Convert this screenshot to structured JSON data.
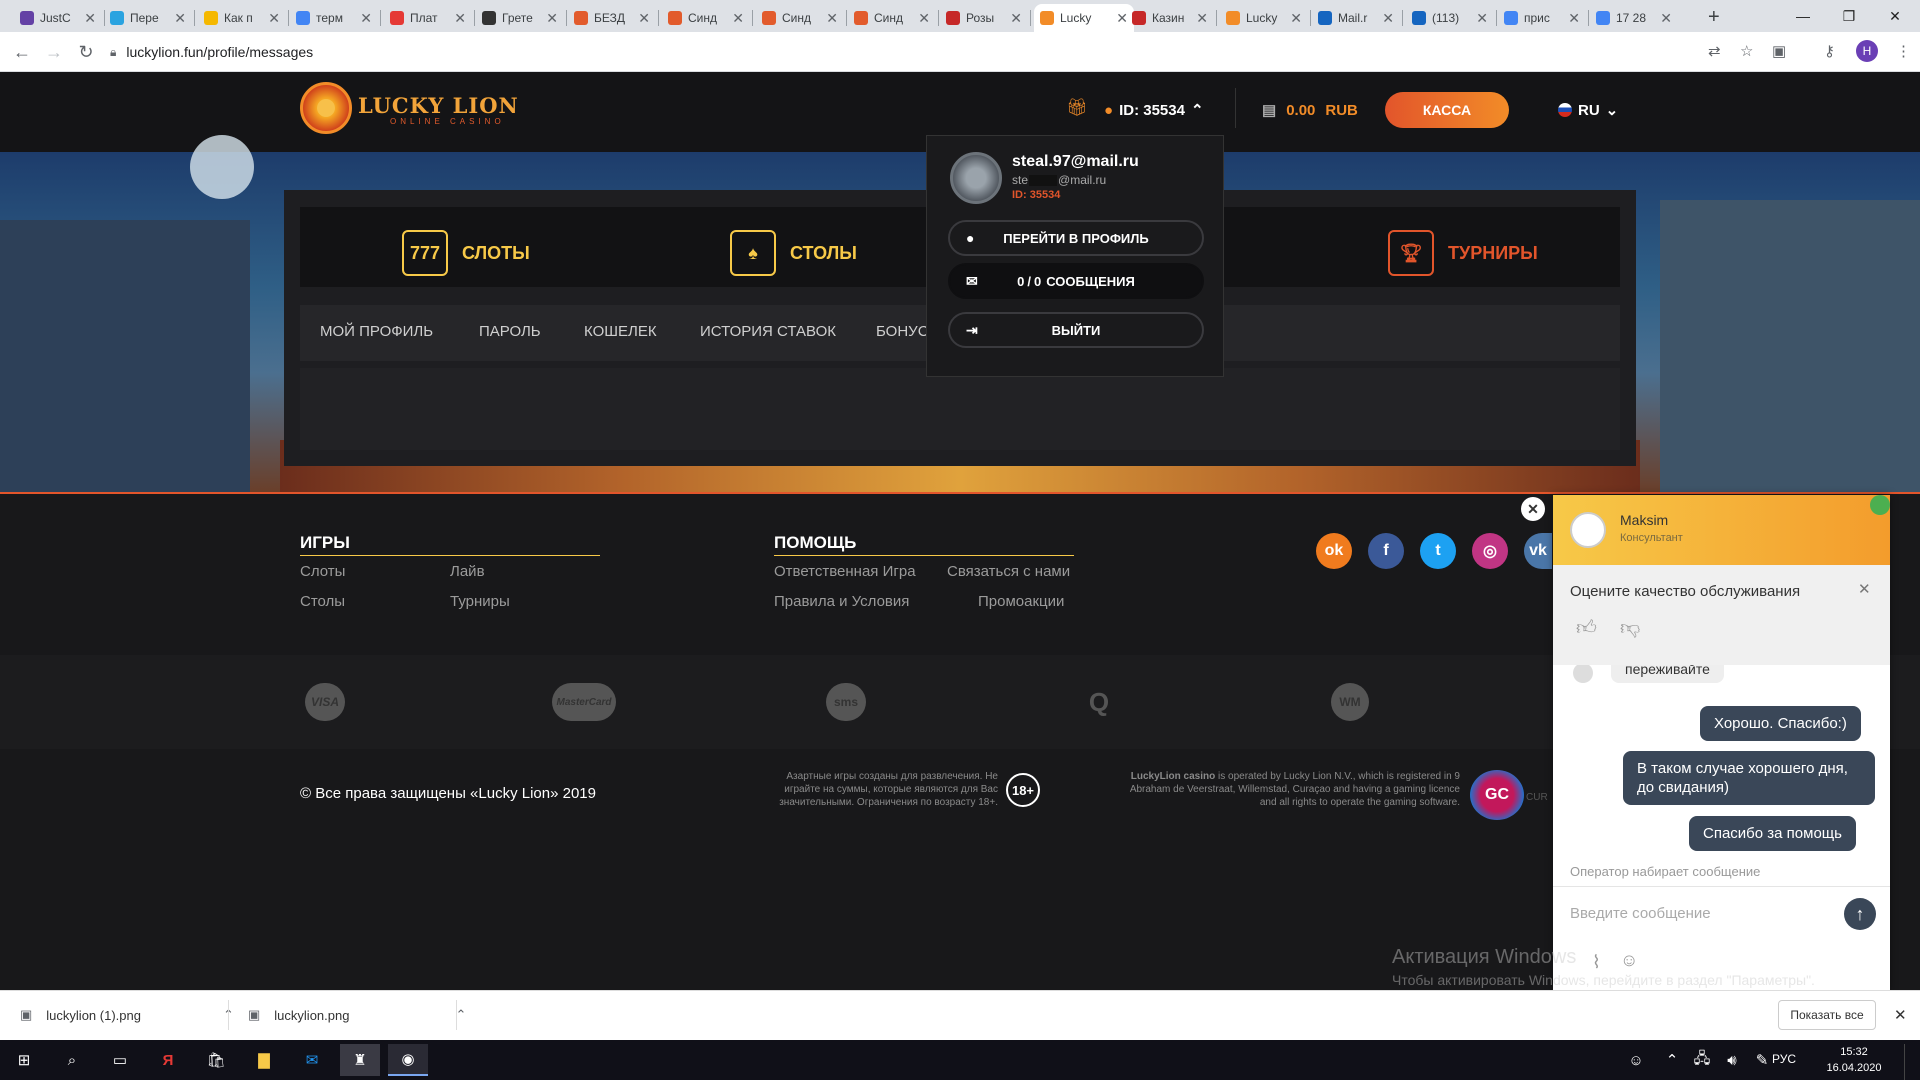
{
  "browser": {
    "tabs": [
      {
        "title": "JustC",
        "color": "#6441a5"
      },
      {
        "title": "Пере",
        "color": "#2aa3e0"
      },
      {
        "title": "Как п",
        "color": "#f5b800"
      },
      {
        "title": "терм",
        "color": "#4285f4"
      },
      {
        "title": "Плат",
        "color": "#e53935"
      },
      {
        "title": "Грете",
        "color": "#333333"
      },
      {
        "title": "БЕЗД",
        "color": "#e25b2c"
      },
      {
        "title": "Синд",
        "color": "#e25b2c"
      },
      {
        "title": "Синд",
        "color": "#e25b2c"
      },
      {
        "title": "Синд",
        "color": "#e25b2c"
      },
      {
        "title": "Розы",
        "color": "#c62828"
      },
      {
        "title": "Lucky",
        "color": "#f28c28",
        "active": true
      },
      {
        "title": "Казин",
        "color": "#c62828"
      },
      {
        "title": "Lucky",
        "color": "#f28c28"
      },
      {
        "title": "Mail.r",
        "color": "#1565c0"
      },
      {
        "title": "(113)",
        "color": "#1565c0"
      },
      {
        "title": "прис",
        "color": "#4285f4"
      },
      {
        "title": "17 28",
        "color": "#4285f4"
      }
    ],
    "new_tab": "+",
    "url": "luckylion.fun/profile/messages",
    "profile_letter": "H"
  },
  "header": {
    "logo_text": "LUCKY LION",
    "logo_sub": "ONLINE CASINO",
    "user_id": "ID: 35534",
    "balance": "0.00",
    "currency": "RUB",
    "cashier": "КАССА",
    "lang": "RU"
  },
  "dropdown": {
    "email": "steal.97@mail.ru",
    "email_masked_prefix": "ste",
    "email_masked_suffix": "@mail.ru",
    "id": "ID: 35534",
    "profile": "ПЕРЕЙТИ В ПРОФИЛЬ",
    "messages_count": "0",
    "messages_sep": "/",
    "messages_total": "0",
    "messages_label": "СООБЩЕНИЯ",
    "logout": "ВЫЙТИ"
  },
  "categories": [
    "СЛОТЫ",
    "СТОЛЫ",
    "ТУРНИРЫ"
  ],
  "profile_nav": [
    "МОЙ ПРОФИЛЬ",
    "ПАРОЛЬ",
    "КОШЕЛЕК",
    "ИСТОРИЯ СТАВОК",
    "БОНУС"
  ],
  "footer": {
    "games_title": "ИГРЫ",
    "games_links": [
      "Слоты",
      "Лайв",
      "Столы",
      "Турниры"
    ],
    "help_title": "ПОМОЩЬ",
    "help_links": [
      "Ответственная Игра",
      "Связаться с нами",
      "Правила и Условия",
      "Промоакции"
    ],
    "socials": [
      {
        "name": "ok",
        "glyph": "ok",
        "color": "#f07b1e"
      },
      {
        "name": "facebook",
        "glyph": "f",
        "color": "#3b5998"
      },
      {
        "name": "twitter",
        "glyph": "t",
        "color": "#1da1f2"
      },
      {
        "name": "instagram",
        "glyph": "◎",
        "color": "#c13584"
      },
      {
        "name": "vk",
        "glyph": "vk",
        "color": "#4a76a8"
      }
    ],
    "payments": [
      "VISA",
      "MasterCard",
      "sms",
      "Q",
      "WM"
    ],
    "copyright": "© Все права защищены «Lucky Lion» 2019",
    "disclaimer": "Азартные игры созданы для развлечения. Не играйте на суммы, которые являются для Вас значительными. Ограничения по возрасту 18+.",
    "age": "18+",
    "license_bold": "LuckyLion casino",
    "license": " is operated by Lucky Lion N.V., which is registered in 9 Abraham de Veerstraat, Willemstad, Curaçao and having a gaming licence and all rights to operate the gaming software.",
    "gc": "GC",
    "gc_suffix": "CUR"
  },
  "chat": {
    "agent_name": "Maksim",
    "agent_role": "Консультант",
    "rate_text": "Оцените качество обслуживания",
    "partial_msg": "переживайте",
    "messages": [
      "Хорошо. Спасибо:)",
      "В таком случае хорошего дня, до свидания)",
      "Спасибо за помощь"
    ],
    "typing": "Оператор набирает сообщение",
    "input_placeholder": "Введите сообщение"
  },
  "windows_watermark": {
    "title": "Активация Windows",
    "sub": "Чтобы активировать Windows, перейдите в раздел \"Параметры\"."
  },
  "downloads": {
    "items": [
      "luckylion (1).png",
      "luckylion.png"
    ],
    "show_all": "Показать все"
  },
  "taskbar": {
    "lang": "РУС",
    "time": "15:32",
    "date": "16.04.2020"
  }
}
